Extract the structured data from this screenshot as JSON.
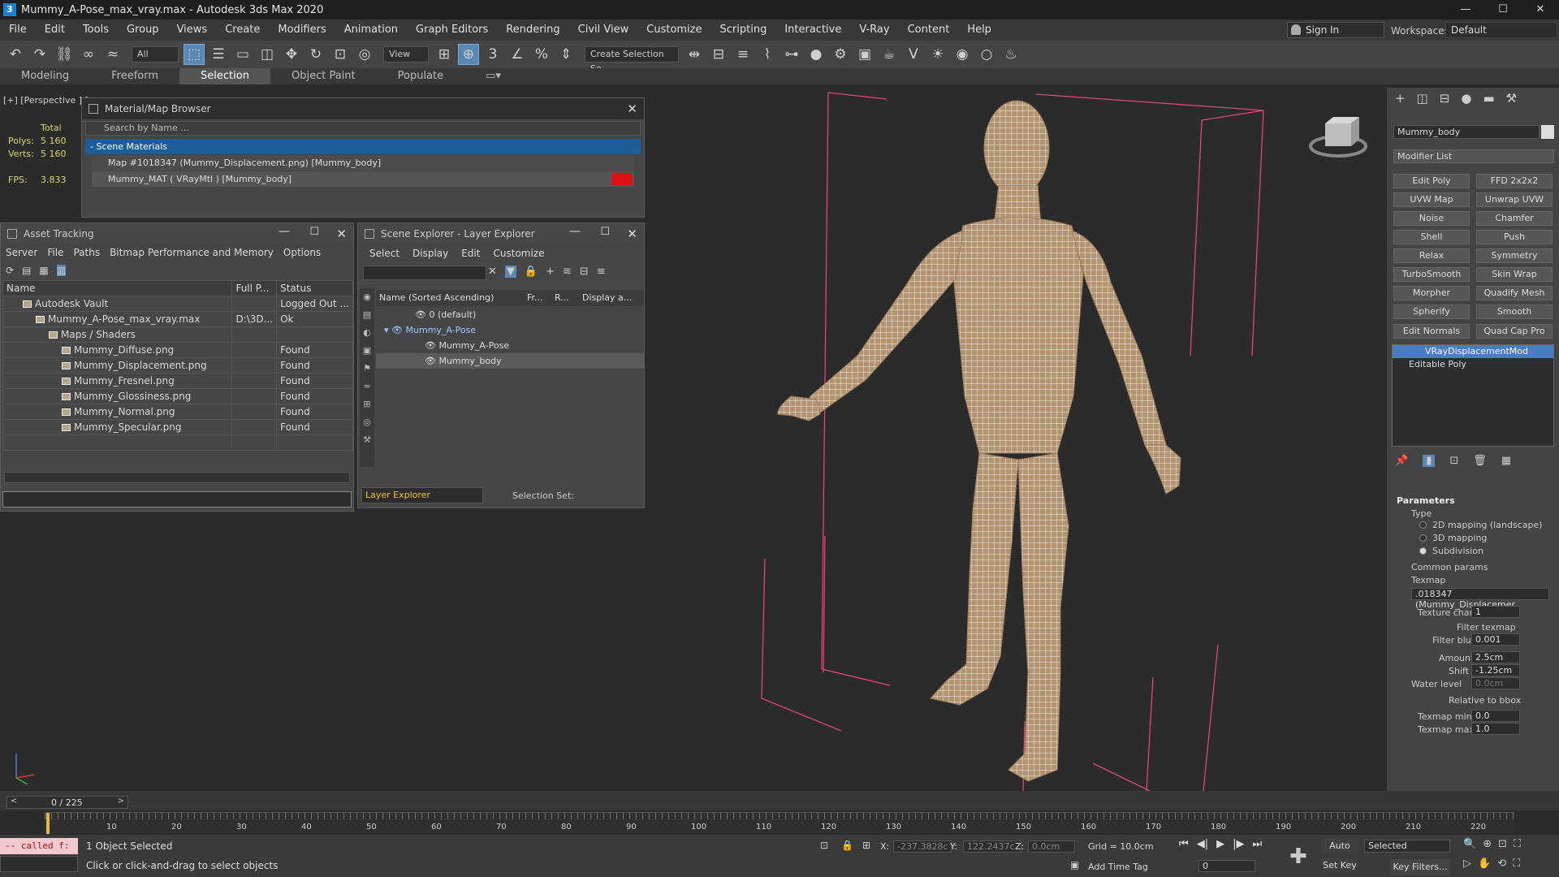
{
  "window": {
    "title": "Mummy_A-Pose_max_vray.max - Autodesk 3ds Max 2020",
    "logo_text": "3",
    "minimize": "—",
    "maximize": "☐",
    "close": "✕"
  },
  "menubar": [
    "File",
    "Edit",
    "Tools",
    "Group",
    "Views",
    "Create",
    "Modifiers",
    "Animation",
    "Graph Editors",
    "Rendering",
    "Civil View",
    "Customize",
    "Scripting",
    "Interactive",
    "V-Ray",
    "Content",
    "Help"
  ],
  "account": {
    "sign_in": "Sign In",
    "workspaces_label": "Workspaces:",
    "workspace_value": "Default"
  },
  "toolbar": {
    "selection_filter": "All",
    "ref_coord": "View",
    "named_selection": "Create Selection Se"
  },
  "ribbon_tabs": [
    {
      "label": "Modeling",
      "active": false
    },
    {
      "label": "Freeform",
      "active": false
    },
    {
      "label": "Selection",
      "active": true
    },
    {
      "label": "Object Paint",
      "active": false
    },
    {
      "label": "Populate",
      "active": false
    }
  ],
  "viewport": {
    "label": "[+] [Perspective ] [",
    "stats": {
      "total_label": "Total",
      "polys_label": "Polys:",
      "polys_value": "5 160",
      "verts_label": "Verts:",
      "verts_value": "5 160",
      "fps_label": "FPS:",
      "fps_value": "3.833"
    },
    "mesh_color": "#b29472"
  },
  "material_browser": {
    "title": "Material/Map Browser",
    "search_placeholder": "Search by Name ...",
    "section": "- Scene Materials",
    "items": [
      "Map #1018347 (Mummy_Displacement.png)  [Mummy_body]",
      "Mummy_MAT  ( VRayMtl )  [Mummy_body]"
    ]
  },
  "asset_tracking": {
    "title": "Asset Tracking",
    "menu": [
      "Server",
      "File",
      "Paths",
      "Bitmap Performance and Memory",
      "Options"
    ],
    "columns": [
      "Name",
      "Full P...",
      "Status"
    ],
    "rows": [
      {
        "name": "Autodesk Vault",
        "path": "",
        "status": "Logged Out ...",
        "indent": 1
      },
      {
        "name": "Mummy_A-Pose_max_vray.max",
        "path": "D:\\3D...",
        "status": "Ok",
        "indent": 2
      },
      {
        "name": "Maps / Shaders",
        "path": "",
        "status": "",
        "indent": 3
      },
      {
        "name": "Mummy_Diffuse.png",
        "path": "",
        "status": "Found",
        "indent": 4
      },
      {
        "name": "Mummy_Displacement.png",
        "path": "",
        "status": "Found",
        "indent": 4
      },
      {
        "name": "Mummy_Fresnel.png",
        "path": "",
        "status": "Found",
        "indent": 4
      },
      {
        "name": "Mummy_Glossiness.png",
        "path": "",
        "status": "Found",
        "indent": 4
      },
      {
        "name": "Mummy_Normal.png",
        "path": "",
        "status": "Found",
        "indent": 4
      },
      {
        "name": "Mummy_Specular.png",
        "path": "",
        "status": "Found",
        "indent": 4
      }
    ]
  },
  "scene_explorer": {
    "title": "Scene Explorer - Layer Explorer",
    "menu": [
      "Select",
      "Display",
      "Edit",
      "Customize"
    ],
    "columns": [
      "Name (Sorted Ascending)",
      "Fr...",
      "R...",
      "Display a..."
    ],
    "rows": [
      {
        "name": "0 (default)",
        "indent": 0,
        "selected": false
      },
      {
        "name": "Mummy_A-Pose",
        "indent": 0,
        "selected": false
      },
      {
        "name": "Mummy_A-Pose",
        "indent": 1,
        "selected": false
      },
      {
        "name": "Mummy_body",
        "indent": 1,
        "selected": true
      }
    ],
    "footer_explorer": "Layer Explorer",
    "footer_selection_set": "Selection Set:"
  },
  "command_panel": {
    "object_name": "Mummy_body",
    "modifier_list": "Modifier List",
    "buttons": [
      "Edit Poly",
      "FFD 2x2x2",
      "UVW Map",
      "Unwrap UVW",
      "Noise",
      "Chamfer",
      "Shell",
      "Push",
      "Relax",
      "Symmetry",
      "TurboSmooth",
      "Skin Wrap",
      "Morpher",
      "Quadify Mesh",
      "Spherify",
      "Smooth",
      "Edit Normals",
      "Quad Cap Pro"
    ],
    "stack": [
      "VRayDisplacementMod",
      "Editable Poly"
    ],
    "params": {
      "rollout": "Parameters",
      "type_label": "Type",
      "types": [
        "2D mapping (landscape)",
        "3D mapping",
        "Subdivision"
      ],
      "selected_type": 2,
      "common": "Common params",
      "texmap_label": "Texmap",
      "texmap_value": ".018347 (Mummy_Displacemer",
      "texture_chan_label": "Texture chan",
      "texture_chan_value": "1",
      "filter_texmap": "Filter texmap",
      "filter_blur_label": "Filter blur",
      "filter_blur_value": "0.001",
      "amount_label": "Amount",
      "amount_value": "2.5cm",
      "shift_label": "Shift",
      "shift_value": "-1.25cm",
      "water_label": "Water level",
      "water_value": "0.0cm",
      "relative_bbox": "Relative to bbox",
      "texmap_min_label": "Texmap min",
      "texmap_min_value": "0.0",
      "texmap_max_label": "Texmap max",
      "texmap_max_value": "1.0"
    }
  },
  "timeline": {
    "frame": "0 / 225",
    "ticks": [
      "10",
      "20",
      "30",
      "40",
      "50",
      "60",
      "70",
      "80",
      "90",
      "100",
      "110",
      "120",
      "130",
      "140",
      "150",
      "160",
      "170",
      "180",
      "190",
      "200",
      "210",
      "220"
    ]
  },
  "status": {
    "maxscript": "-- called f:",
    "objects": "1 Object Selected",
    "prompt": "Click or click-and-drag to select objects",
    "x_label": "X:",
    "x_value": "-237.3828c",
    "y_label": "Y:",
    "y_value": "122.2437c",
    "z_label": "Z:",
    "z_value": "0.0cm",
    "grid": "Grid = 10.0cm",
    "add_time_tag": "Add Time Tag",
    "auto_key": "Auto Key",
    "set_key": "Set Key",
    "selected": "Selected",
    "key_filters": "Key Filters...",
    "frame_value": "0"
  }
}
